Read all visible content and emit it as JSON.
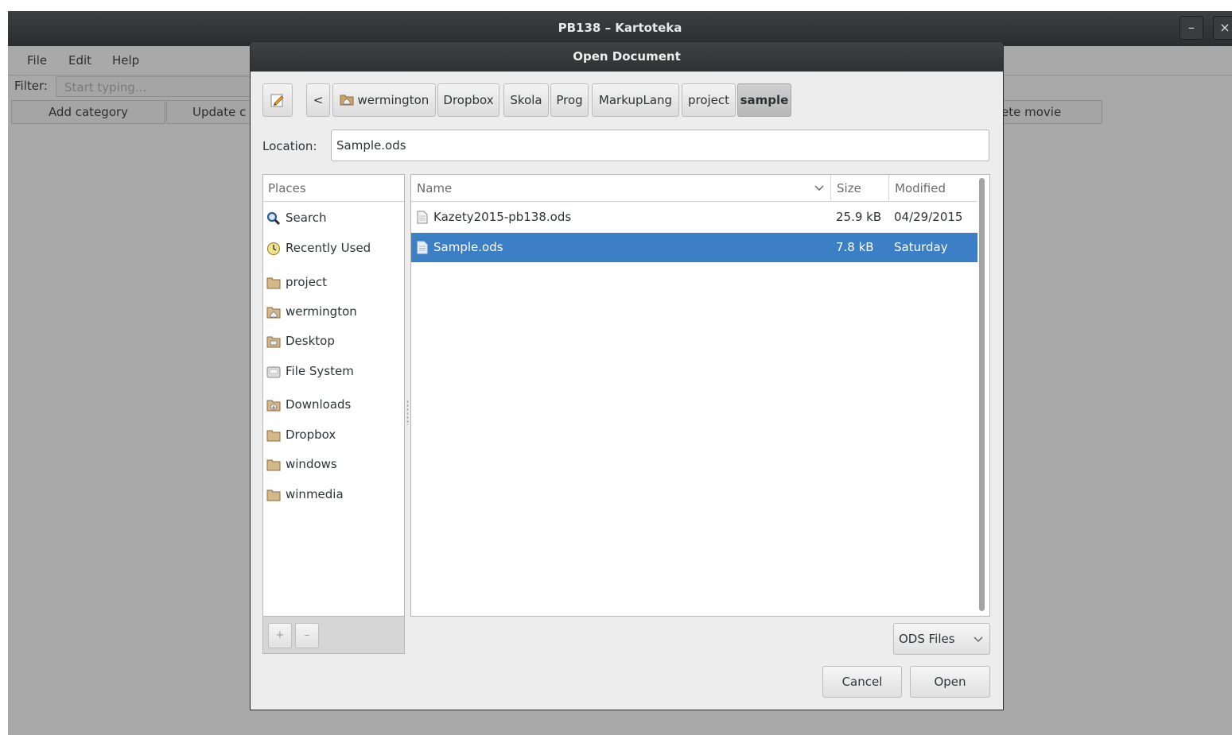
{
  "main_window": {
    "title": "PB138 – Kartoteka",
    "minimize": "–",
    "close": "×",
    "menu": [
      "File",
      "Edit",
      "Help"
    ],
    "filter_label": "Filter:",
    "filter_placeholder": "Start typing...",
    "toolbar": {
      "add_category": "Add category",
      "update": "Update c",
      "delete_movie": "ete movie"
    }
  },
  "dialog": {
    "title": "Open Document",
    "back": "<",
    "breadcrumb": [
      "wermington",
      "Dropbox",
      "Skola",
      "Prog",
      "MarkupLang",
      "project",
      "sample"
    ],
    "active_crumb": "sample",
    "location_label": "Location:",
    "location_value": "Sample.ods",
    "places_header": "Places",
    "places": [
      {
        "label": "Search",
        "icon": "search-icon"
      },
      {
        "label": "Recently Used",
        "icon": "clock-icon"
      },
      {
        "label": "project",
        "icon": "folder-icon"
      },
      {
        "label": "wermington",
        "icon": "home-folder-icon"
      },
      {
        "label": "Desktop",
        "icon": "desktop-folder-icon"
      },
      {
        "label": "File System",
        "icon": "drive-icon"
      },
      {
        "label": "Downloads",
        "icon": "downloads-folder-icon"
      },
      {
        "label": "Dropbox",
        "icon": "folder-icon"
      },
      {
        "label": "windows",
        "icon": "folder-icon"
      },
      {
        "label": "winmedia",
        "icon": "folder-icon"
      }
    ],
    "add_place": "+",
    "remove_place": "–",
    "columns": {
      "name": "Name",
      "size": "Size",
      "modified": "Modified"
    },
    "files": [
      {
        "name": "Kazety2015-pb138.ods",
        "size": "25.9 kB",
        "modified": "04/29/2015",
        "selected": false
      },
      {
        "name": "Sample.ods",
        "size": "7.8 kB",
        "modified": "Saturday",
        "selected": true
      }
    ],
    "file_filter": "ODS Files",
    "cancel": "Cancel",
    "open": "Open",
    "colors": {
      "selection": "#3c7fc6",
      "titlebar": "#2f3132",
      "backdrop": "#a8a8a8"
    }
  }
}
